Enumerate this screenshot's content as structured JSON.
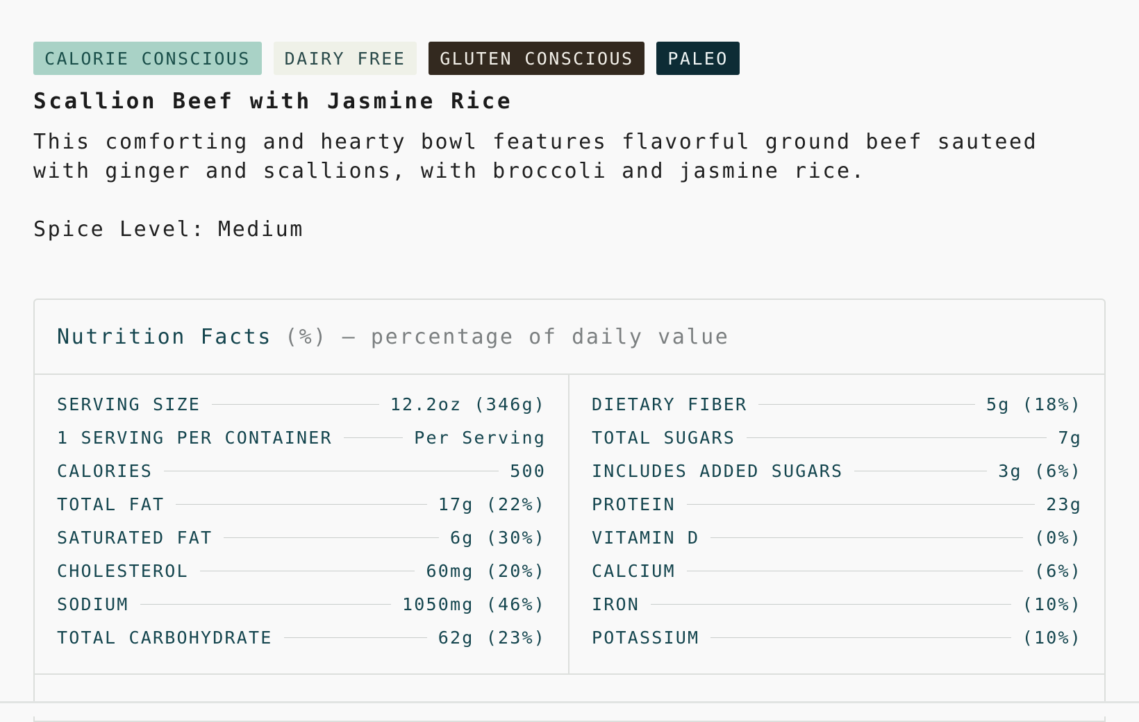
{
  "tags": [
    {
      "label": "CALORIE CONSCIOUS",
      "bg": "#a9d2c6",
      "fg": "#1a4f4a"
    },
    {
      "label": "DAIRY FREE",
      "bg": "#eff1e8",
      "fg": "#2a4a4a"
    },
    {
      "label": "GLUTEN CONSCIOUS",
      "bg": "#33291f",
      "fg": "#f2efe8"
    },
    {
      "label": "PALEO",
      "bg": "#0d2c35",
      "fg": "#eef4f4"
    }
  ],
  "meal": {
    "title": "Scallion Beef with Jasmine Rice",
    "description": "This comforting and hearty bowl features flavorful ground beef sauteed with ginger and scallions, with broccoli and jasmine rice.",
    "spice_label": "Spice Level:",
    "spice_value": "Medium"
  },
  "nutrition": {
    "title": "Nutrition Facts",
    "subtitle": "(%) – percentage of daily value",
    "left": [
      {
        "label": "SERVING SIZE",
        "value": "12.2oz (346g)"
      },
      {
        "label": "1 SERVING PER CONTAINER",
        "value": "Per Serving"
      },
      {
        "label": "CALORIES",
        "value": "500"
      },
      {
        "label": "TOTAL FAT",
        "value": "17g (22%)"
      },
      {
        "label": "SATURATED FAT",
        "value": "6g (30%)"
      },
      {
        "label": "CHOLESTEROL",
        "value": "60mg (20%)"
      },
      {
        "label": "SODIUM",
        "value": "1050mg (46%)"
      },
      {
        "label": "TOTAL CARBOHYDRATE",
        "value": "62g (23%)"
      }
    ],
    "right": [
      {
        "label": "DIETARY FIBER",
        "value": "5g (18%)"
      },
      {
        "label": "TOTAL SUGARS",
        "value": "7g"
      },
      {
        "label": "INCLUDES ADDED SUGARS",
        "value": "3g (6%)"
      },
      {
        "label": "PROTEIN",
        "value": "23g"
      },
      {
        "label": "VITAMIN D",
        "value": "(0%)"
      },
      {
        "label": "CALCIUM",
        "value": "(6%)"
      },
      {
        "label": "IRON",
        "value": "(10%)"
      },
      {
        "label": "POTASSIUM",
        "value": "(10%)"
      }
    ]
  }
}
